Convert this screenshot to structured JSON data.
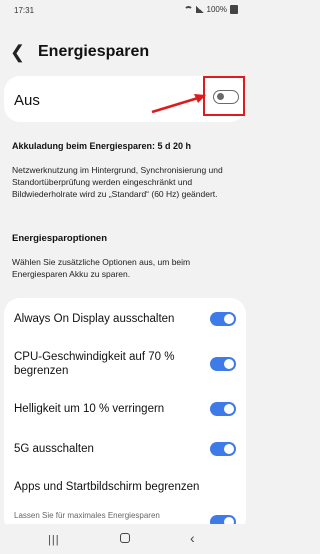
{
  "status": {
    "time": "17:31",
    "battery": "100%"
  },
  "header": {
    "title": "Energiesparen"
  },
  "main_toggle": {
    "label": "Aus",
    "state": "off"
  },
  "info": {
    "charge_line": "Akkuladung beim Energiesparen: 5 d 20 h",
    "description": "Netzwerknutzung im Hintergrund, Synchronisierung und Standortüberprüfung werden eingeschränkt und Bildwiederholrate wird zu „Standard“ (60 Hz) geändert."
  },
  "options_section": {
    "title": "Energiesparoptionen",
    "description": "Wählen Sie zusätzliche Optionen aus, um beim Energiesparen Akku zu sparen."
  },
  "options": [
    {
      "label": "Always On Display ausschalten",
      "state": "on"
    },
    {
      "label": "CPU-Geschwindigkeit auf 70 % begrenzen",
      "state": "on"
    },
    {
      "label": "Helligkeit um 10 % verringern",
      "state": "on"
    },
    {
      "label": "5G ausschalten",
      "state": "on"
    },
    {
      "label": "Apps und Startbildschirm begrenzen",
      "sub": "Lassen Sie für maximales Energiesparen",
      "state": "on"
    }
  ],
  "colors": {
    "accent": "#3e7be8",
    "highlight": "#e01b1b",
    "background": "#f2f2f2"
  },
  "icons": [
    "wifi-icon",
    "signal-icon",
    "battery-icon",
    "back-arrow-icon",
    "recent-apps-icon",
    "home-icon",
    "nav-back-icon"
  ]
}
